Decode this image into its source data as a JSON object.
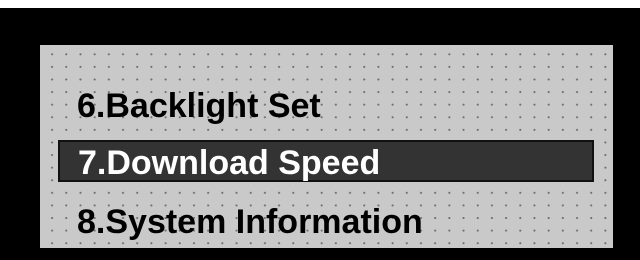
{
  "screen": {
    "menu": {
      "items": [
        {
          "label": "6.Backlight Set",
          "selected": false
        },
        {
          "label": "7.Download Speed",
          "selected": true
        },
        {
          "label": "8.System Information",
          "selected": false
        }
      ]
    }
  },
  "colors": {
    "bezel": "#000000",
    "lcd_background": "#c9c9c9",
    "lcd_dots": "#6f6f6f",
    "highlight_background": "#333333",
    "highlight_text": "#ffffff",
    "text": "#000000"
  }
}
